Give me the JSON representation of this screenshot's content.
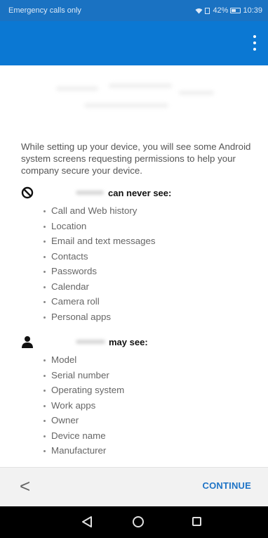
{
  "status_bar": {
    "carrier": "Emergency calls only",
    "battery": "42%",
    "time": "10:39"
  },
  "app_bar": {
    "menu_icon": "more-vert-icon"
  },
  "intro": "While setting up your device, you will see some Android system screens requesting permissions to help your company secure your device.",
  "never_see": {
    "icon": "block-icon",
    "label": "can never see:",
    "items": [
      "Call and Web history",
      "Location",
      "Email and text messages",
      "Contacts",
      "Passwords",
      "Calendar",
      "Camera roll",
      "Personal apps"
    ]
  },
  "may_see": {
    "icon": "person-icon",
    "label": "may see:",
    "items": [
      "Model",
      "Serial number",
      "Operating system",
      "Work apps",
      "Owner",
      "Device name",
      "Manufacturer"
    ]
  },
  "bottom_bar": {
    "back_label": "<",
    "continue_label": "CONTINUE"
  },
  "colors": {
    "app_bar": "#0b78d3",
    "status_bar": "#1a72c2",
    "accent": "#1f74c6"
  }
}
